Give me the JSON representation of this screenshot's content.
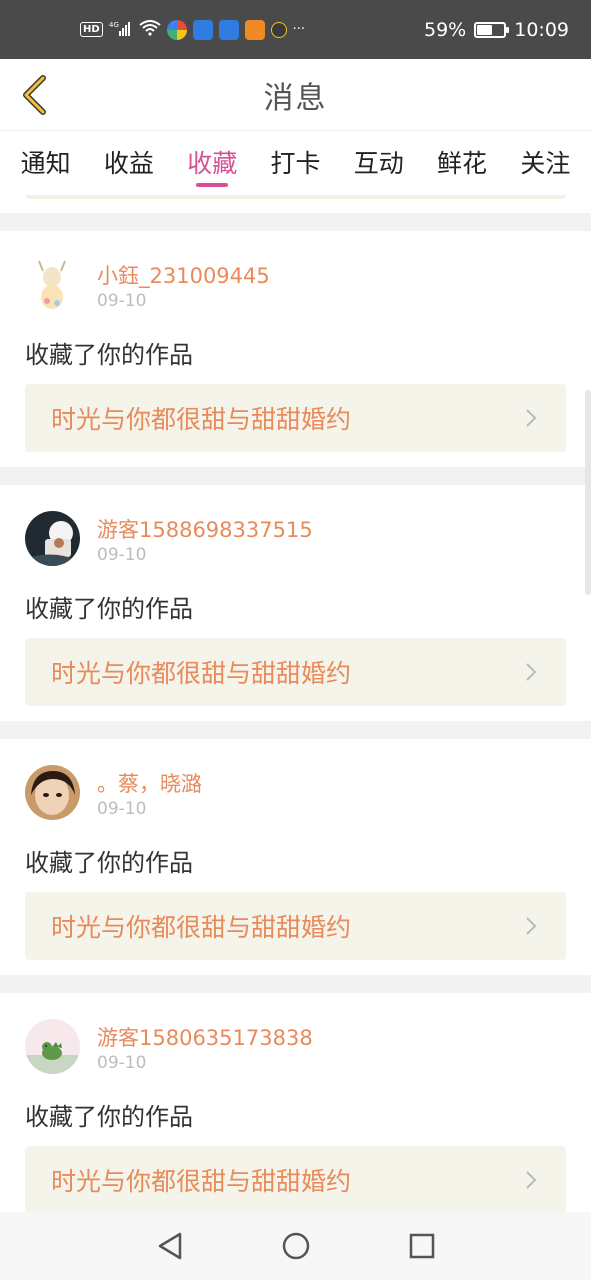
{
  "status_bar": {
    "network": "4G",
    "hd": "HD",
    "more": "···",
    "battery_percent_text": "59%",
    "battery_level": 0.59,
    "time": "10:09"
  },
  "header": {
    "title": "消息",
    "back_icon": "chevron-left-icon"
  },
  "tabs": [
    {
      "label": "通知",
      "active": false
    },
    {
      "label": "收益",
      "active": false
    },
    {
      "label": "收藏",
      "active": true
    },
    {
      "label": "打卡",
      "active": false
    },
    {
      "label": "互动",
      "active": false
    },
    {
      "label": "鲜花",
      "active": false
    },
    {
      "label": "关注",
      "active": false
    }
  ],
  "messages": [
    {
      "username": "小鈺_231009445",
      "date": "09-10",
      "action": "收藏了你的作品",
      "work_title": "时光与你都很甜与甜甜婚约",
      "avatar": "avatar-cartoon"
    },
    {
      "username": "游客1588698337515",
      "date": "09-10",
      "action": "收藏了你的作品",
      "work_title": "时光与你都很甜与甜甜婚约",
      "avatar": "avatar-photo"
    },
    {
      "username": "。蔡，晓潞",
      "date": "09-10",
      "action": "收藏了你的作品",
      "work_title": "时光与你都很甜与甜甜婚约",
      "avatar": "avatar-selfie"
    },
    {
      "username": "游客1580635173838",
      "date": "09-10",
      "action": "收藏了你的作品",
      "work_title": "时光与你都很甜与甜甜婚约",
      "avatar": "avatar-dinosaur"
    }
  ],
  "colors": {
    "accent": "#d94f96",
    "username": "#e98a5a",
    "work_box_bg": "#f5f4ea"
  },
  "nav": [
    "back-triangle-icon",
    "home-circle-icon",
    "recents-square-icon"
  ]
}
